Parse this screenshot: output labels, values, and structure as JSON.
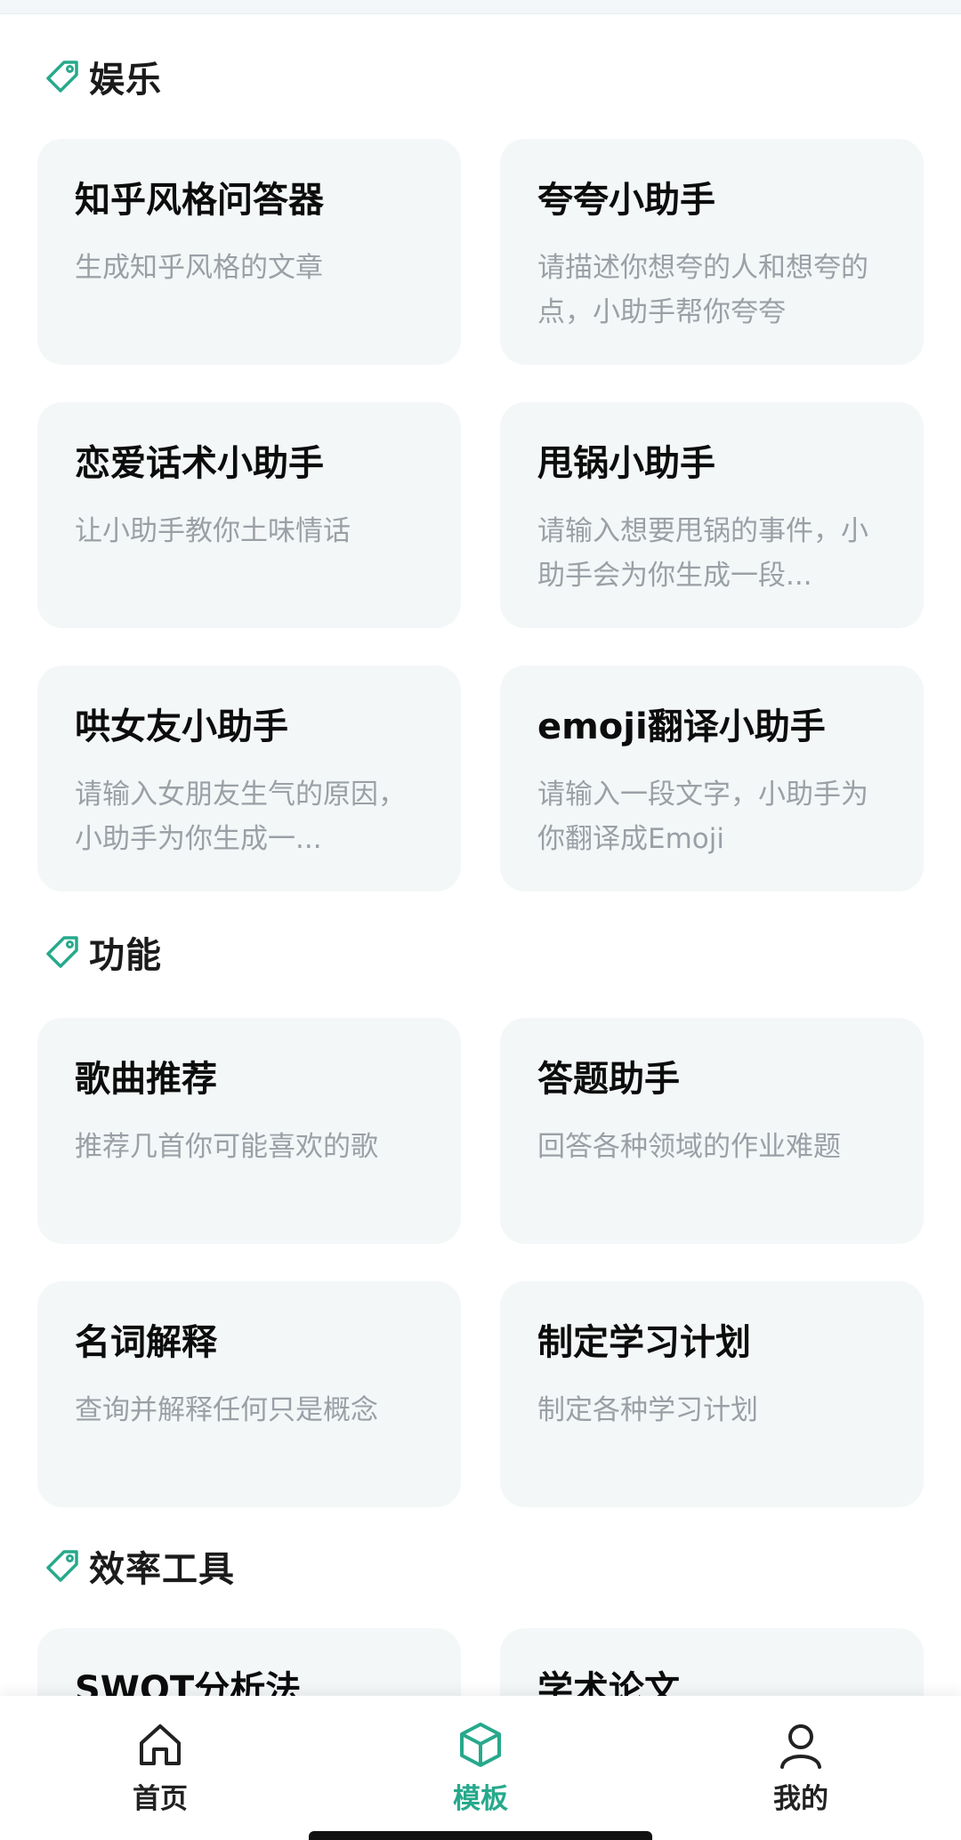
{
  "accent_color": "#27a98c",
  "sections": [
    {
      "title": "娱乐",
      "icon": "tag-icon",
      "cards": [
        {
          "title": "知乎风格问答器",
          "desc": "生成知乎风格的文章"
        },
        {
          "title": "夸夸小助手",
          "desc": "请描述你想夸的人和想夸的点，小助手帮你夸夸"
        },
        {
          "title": "恋爱话术小助手",
          "desc": "让小助手教你土味情话"
        },
        {
          "title": "甩锅小助手",
          "desc": "请输入想要甩锅的事件，小助手会为你生成一段..."
        },
        {
          "title": "哄女友小助手",
          "desc": "请输入女朋友生气的原因，小助手为你生成一..."
        },
        {
          "title": "emoji翻译小助手",
          "desc": "请输入一段文字，小助手为你翻译成Emoji"
        }
      ]
    },
    {
      "title": "功能",
      "icon": "tag-icon",
      "cards": [
        {
          "title": "歌曲推荐",
          "desc": "推荐几首你可能喜欢的歌"
        },
        {
          "title": "答题助手",
          "desc": "回答各种领域的作业难题"
        },
        {
          "title": "名词解释",
          "desc": "查询并解释任何只是概念"
        },
        {
          "title": "制定学习计划",
          "desc": "制定各种学习计划"
        }
      ]
    },
    {
      "title": "效率工具",
      "icon": "tag-icon",
      "cards": [
        {
          "title": "SWOT分析法",
          "desc": ""
        },
        {
          "title": "学术论文",
          "desc": ""
        }
      ]
    }
  ],
  "tabbar": {
    "items": [
      {
        "label": "首页",
        "icon": "home-icon",
        "active": false
      },
      {
        "label": "模板",
        "icon": "cube-icon",
        "active": true
      },
      {
        "label": "我的",
        "icon": "user-icon",
        "active": false
      }
    ]
  }
}
